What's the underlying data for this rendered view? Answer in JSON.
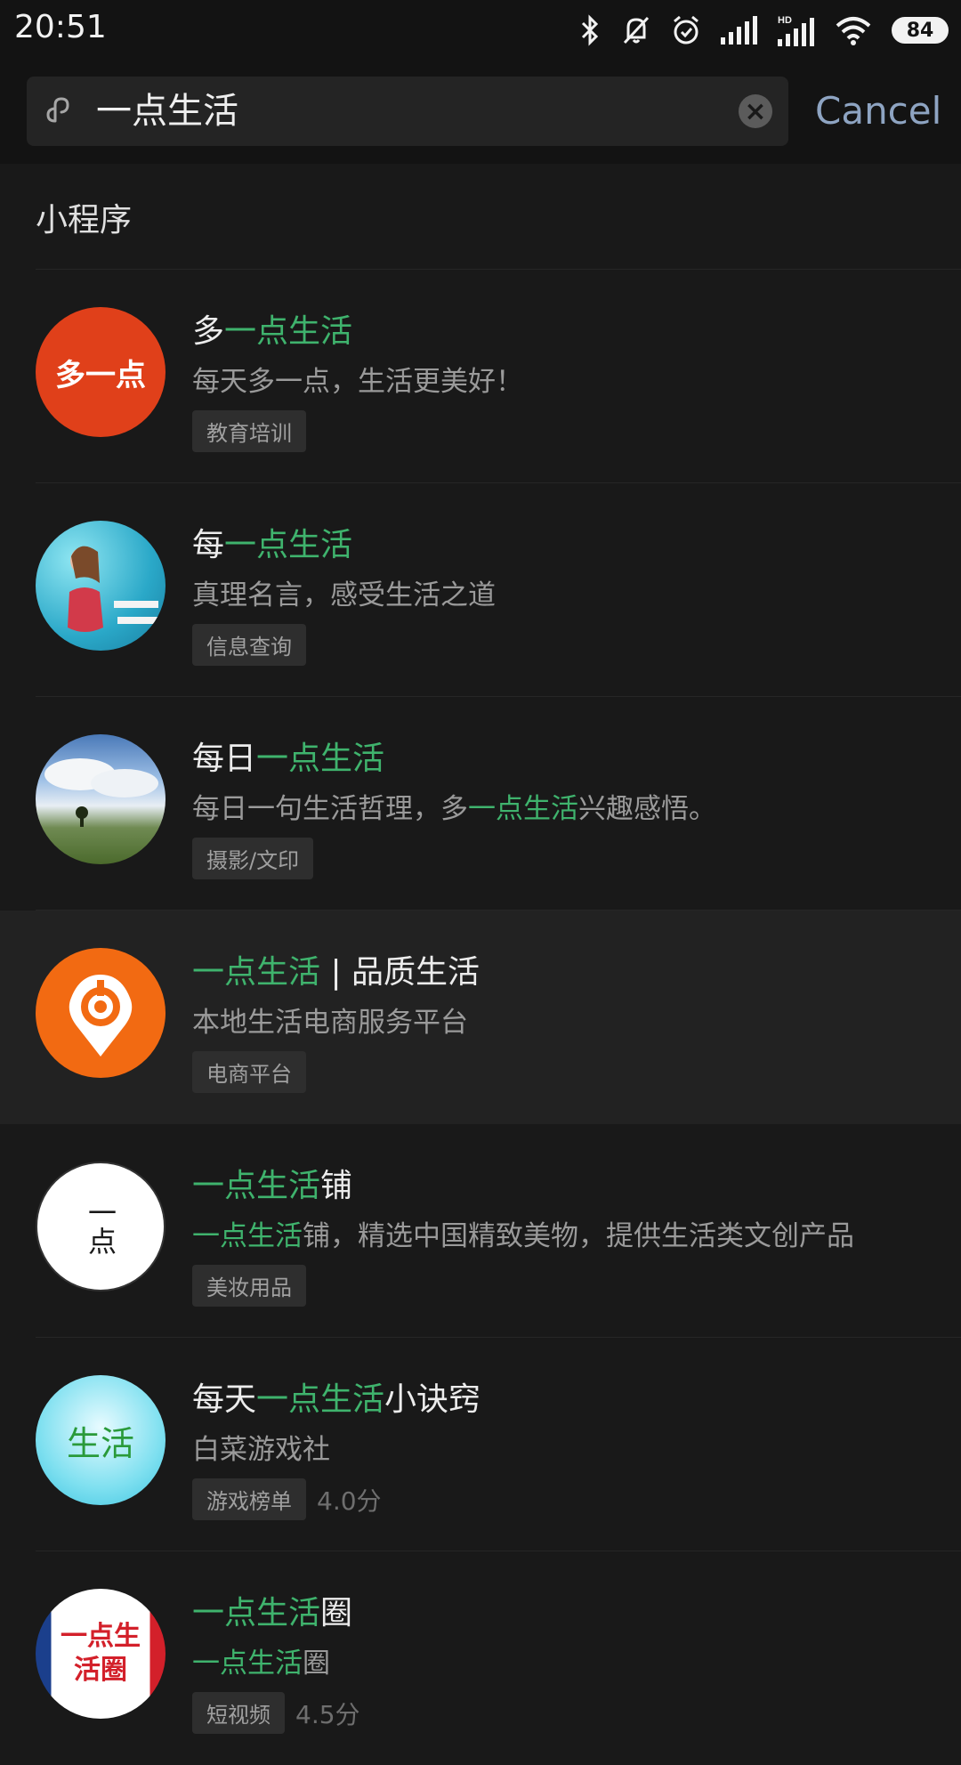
{
  "status": {
    "time": "20:51",
    "battery": "84"
  },
  "search": {
    "query": "一点生活",
    "cancel": "Cancel"
  },
  "section": {
    "title": "小程序"
  },
  "items": [
    {
      "title": [
        {
          "t": "多",
          "hl": false
        },
        {
          "t": "一点生活",
          "hl": true
        }
      ],
      "desc": [
        {
          "t": "每天多一点，生活更美好！",
          "hl": false
        }
      ],
      "tag": "教育培训",
      "rating": "",
      "avatar_text": "多一点"
    },
    {
      "title": [
        {
          "t": "每",
          "hl": false
        },
        {
          "t": "一点生活",
          "hl": true
        }
      ],
      "desc": [
        {
          "t": "真理名言，感受生活之道",
          "hl": false
        }
      ],
      "tag": "信息查询",
      "rating": ""
    },
    {
      "title": [
        {
          "t": "每日",
          "hl": false
        },
        {
          "t": "一点生活",
          "hl": true
        }
      ],
      "desc": [
        {
          "t": "每日一句生活哲理，多",
          "hl": false
        },
        {
          "t": "一点生活",
          "hl": true
        },
        {
          "t": "兴趣感悟。",
          "hl": false
        }
      ],
      "tag": "摄影/文印",
      "rating": ""
    },
    {
      "title": [
        {
          "t": "一点生活",
          "hl": true
        },
        {
          "t": " | 品质生活",
          "hl": false
        }
      ],
      "desc": [
        {
          "t": "本地生活电商服务平台",
          "hl": false
        }
      ],
      "tag": "电商平台",
      "rating": ""
    },
    {
      "title": [
        {
          "t": "一点生活",
          "hl": true
        },
        {
          "t": "铺",
          "hl": false
        }
      ],
      "desc": [
        {
          "t": "一点生活",
          "hl": true
        },
        {
          "t": "铺，精选中国精致美物，提供生活类文创产品",
          "hl": false
        }
      ],
      "tag": "美妆用品",
      "rating": "",
      "avatar_text": "一点"
    },
    {
      "title": [
        {
          "t": "每天",
          "hl": false
        },
        {
          "t": "一点生活",
          "hl": true
        },
        {
          "t": "小诀窍",
          "hl": false
        }
      ],
      "desc": [
        {
          "t": "白菜游戏社",
          "hl": false
        }
      ],
      "tag": "游戏榜单",
      "rating": "4.0分",
      "avatar_text": "生活"
    },
    {
      "title": [
        {
          "t": "一点生活",
          "hl": true
        },
        {
          "t": "圈",
          "hl": false
        }
      ],
      "desc": [
        {
          "t": "一点生活",
          "hl": true
        },
        {
          "t": "圈",
          "hl": false
        }
      ],
      "tag": "短视频",
      "rating": "4.5分",
      "avatar_text": "一点生活圈"
    }
  ],
  "colors": {
    "highlight": "#3fb36d",
    "cancel": "#8ea4c2",
    "background": "#191919"
  }
}
